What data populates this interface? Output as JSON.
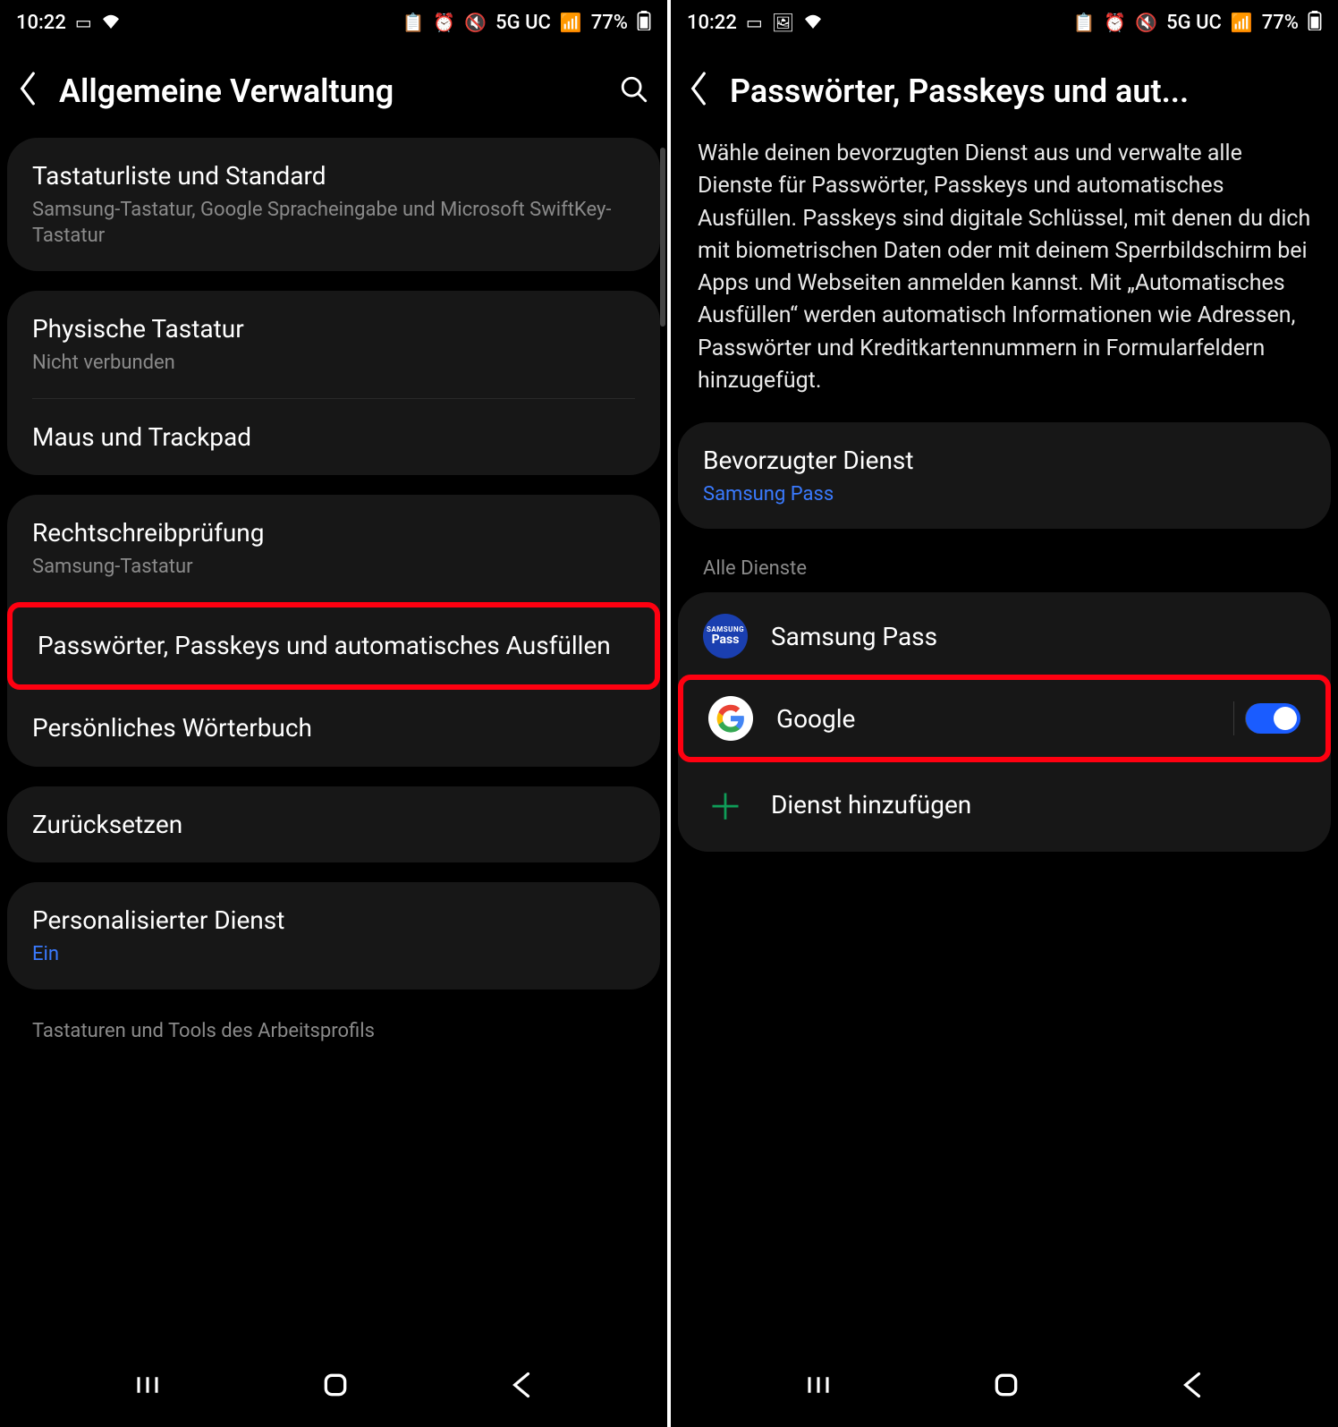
{
  "status": {
    "time": "10:22",
    "network": "5G UC",
    "battery": "77%"
  },
  "left": {
    "title": "Allgemeine Verwaltung",
    "items": {
      "keyboard_list": {
        "title": "Tastaturliste und Standard",
        "sub": "Samsung-Tastatur, Google Spracheingabe und Microsoft SwiftKey-Tastatur"
      },
      "physical_kb": {
        "title": "Physische Tastatur",
        "sub": "Nicht verbunden"
      },
      "mouse": {
        "title": "Maus und Trackpad"
      },
      "spellcheck": {
        "title": "Rechtschreibprüfung",
        "sub": "Samsung-Tastatur"
      },
      "passwords": {
        "title": "Passwörter, Passkeys und automatisches Ausfüllen"
      },
      "dictionary": {
        "title": "Persönliches Wörterbuch"
      },
      "reset": {
        "title": "Zurücksetzen"
      },
      "personalized": {
        "title": "Personalisierter Dienst",
        "sub": "Ein"
      },
      "workprofile": "Tastaturen und Tools des Arbeitsprofils"
    }
  },
  "right": {
    "title": "Passwörter, Passkeys und aut...",
    "desc": "Wähle deinen bevorzugten Dienst aus und verwalte alle Dienste für Passwörter, Passkeys und automatisches Ausfüllen. Passkeys sind digitale Schlüssel, mit denen du dich mit biometrischen Daten oder mit deinem Sperrbildschirm bei Apps und Webseiten anmelden kannst. Mit „Automatisches Ausfüllen“ werden automatisch Informationen wie Adressen, Passwörter und Kreditkartennummern in Formularfeldern hinzugefügt.",
    "preferred": {
      "label": "Bevorzugter Dienst",
      "value": "Samsung Pass"
    },
    "all_label": "Alle Dienste",
    "services": {
      "samsung": "Samsung Pass",
      "google": "Google",
      "add": "Dienst hinzufügen"
    }
  }
}
